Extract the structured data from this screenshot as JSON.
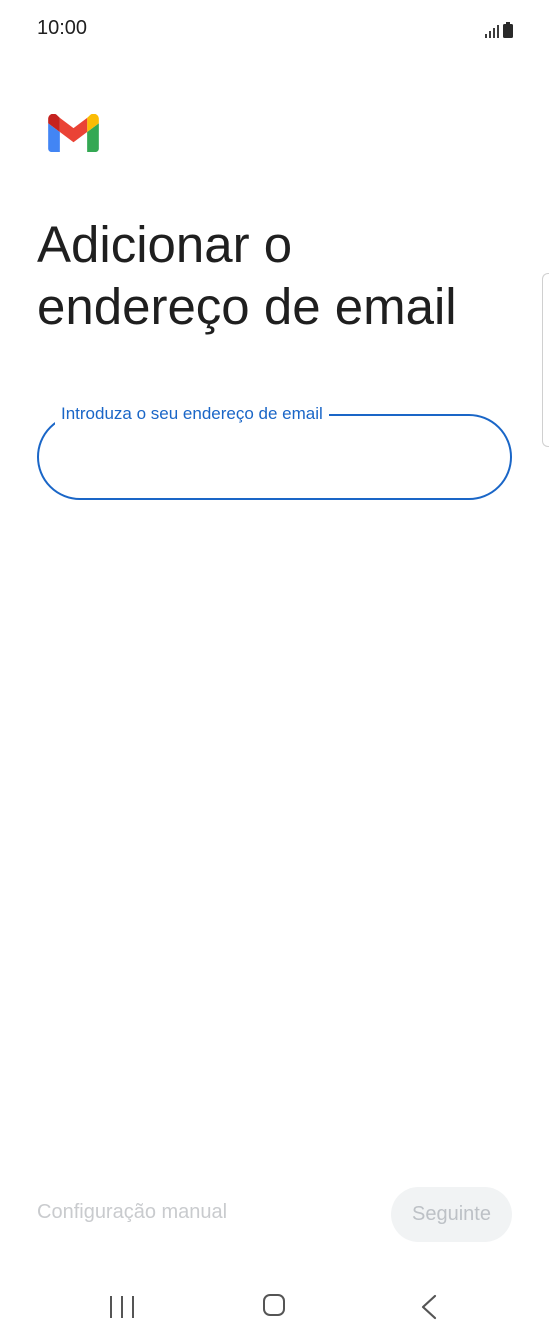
{
  "status_bar": {
    "time": "10:00",
    "icons": [
      "signal-icon",
      "battery-icon"
    ]
  },
  "header": {
    "logo": "gmail-logo",
    "title_line1": "Adicionar o",
    "title_line2": "endereço de email"
  },
  "email_field": {
    "label": "Introduza o seu endereço de email",
    "value": "",
    "focused": true
  },
  "footer": {
    "manual_setup_label": "Configuração manual",
    "next_label": "Seguinte"
  },
  "navigation_bar": {
    "icons": [
      "recents-icon",
      "home-icon",
      "back-icon"
    ]
  },
  "colors": {
    "accent": "#1a66c7",
    "disabled_text": "#c9cbce",
    "gmail_red": "#ea4335",
    "gmail_blue": "#4285f4",
    "gmail_green": "#34a853",
    "gmail_yellow": "#fbbc04"
  }
}
